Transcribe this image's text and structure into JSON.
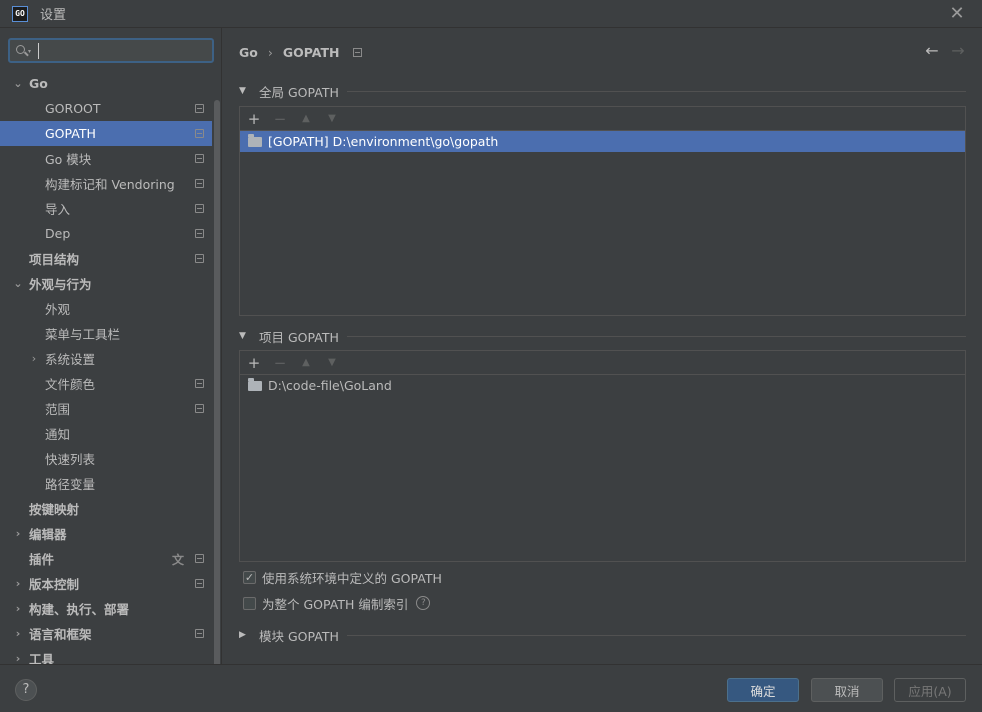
{
  "window": {
    "app_icon_text": "GO",
    "title": "设置",
    "close_symbol": "✕"
  },
  "search": {
    "placeholder": "",
    "value": ""
  },
  "sidebar": {
    "items": [
      {
        "label": "Go",
        "level": 0,
        "expanded": true,
        "bold": true
      },
      {
        "label": "GOROOT",
        "level": 1,
        "settings_mark": true
      },
      {
        "label": "GOPATH",
        "level": 1,
        "selected": true,
        "settings_mark": true
      },
      {
        "label": "Go 模块",
        "level": 1,
        "settings_mark": true
      },
      {
        "label": "构建标记和 Vendoring",
        "level": 1,
        "settings_mark": true
      },
      {
        "label": "导入",
        "level": 1,
        "settings_mark": true
      },
      {
        "label": "Dep",
        "level": 1,
        "settings_mark": true
      },
      {
        "label": "项目结构",
        "level": 0,
        "bold": true,
        "settings_mark": true
      },
      {
        "label": "外观与行为",
        "level": 0,
        "expanded": true,
        "bold": true
      },
      {
        "label": "外观",
        "level": 1
      },
      {
        "label": "菜单与工具栏",
        "level": 1
      },
      {
        "label": "系统设置",
        "level": 1,
        "collapsed": true
      },
      {
        "label": "文件颜色",
        "level": 1,
        "settings_mark": true
      },
      {
        "label": "范围",
        "level": 1,
        "settings_mark": true
      },
      {
        "label": "通知",
        "level": 1
      },
      {
        "label": "快速列表",
        "level": 1
      },
      {
        "label": "路径变量",
        "level": 1
      },
      {
        "label": "按键映射",
        "level": 0,
        "bold": true
      },
      {
        "label": "编辑器",
        "level": 0,
        "collapsed": true,
        "bold": true
      },
      {
        "label": "插件",
        "level": 0,
        "bold": true,
        "settings_mark": true,
        "translate_mark": true
      },
      {
        "label": "版本控制",
        "level": 0,
        "collapsed": true,
        "bold": true,
        "settings_mark": true
      },
      {
        "label": "构建、执行、部署",
        "level": 0,
        "collapsed": true,
        "bold": true
      },
      {
        "label": "语言和框架",
        "level": 0,
        "collapsed": true,
        "bold": true,
        "settings_mark": true
      },
      {
        "label": "工具",
        "level": 0,
        "collapsed": true,
        "bold": true
      }
    ]
  },
  "breadcrumb": {
    "parent": "Go",
    "separator": "›",
    "current": "GOPATH"
  },
  "nav": {
    "back": "←",
    "forward": "→"
  },
  "global_gopath": {
    "title": "全局 GOPATH",
    "toolbar": {
      "add": "+",
      "remove": "−",
      "up": "▲",
      "down": "▼"
    },
    "entries": [
      "[GOPATH] D:\\environment\\go\\gopath"
    ]
  },
  "project_gopath": {
    "title": "项目 GOPATH",
    "toolbar": {
      "add": "+",
      "remove": "−",
      "up": "▲",
      "down": "▼"
    },
    "entries": [
      "D:\\code-file\\GoLand"
    ]
  },
  "options": {
    "use_system_gopath": {
      "label": "使用系统环境中定义的 GOPATH",
      "checked": true,
      "check_symbol": "✓"
    },
    "index_entire_gopath": {
      "label": "为整个 GOPATH 编制索引",
      "checked": false,
      "help": "?"
    }
  },
  "module_gopath": {
    "title": "模块 GOPATH"
  },
  "footer": {
    "help": "?",
    "ok": "确定",
    "cancel": "取消",
    "apply": "应用(A)"
  },
  "colors": {
    "background": "#3c3f41",
    "selection": "#4b6eaf",
    "primary_button": "#365880",
    "search_focus": "#3d6185"
  }
}
